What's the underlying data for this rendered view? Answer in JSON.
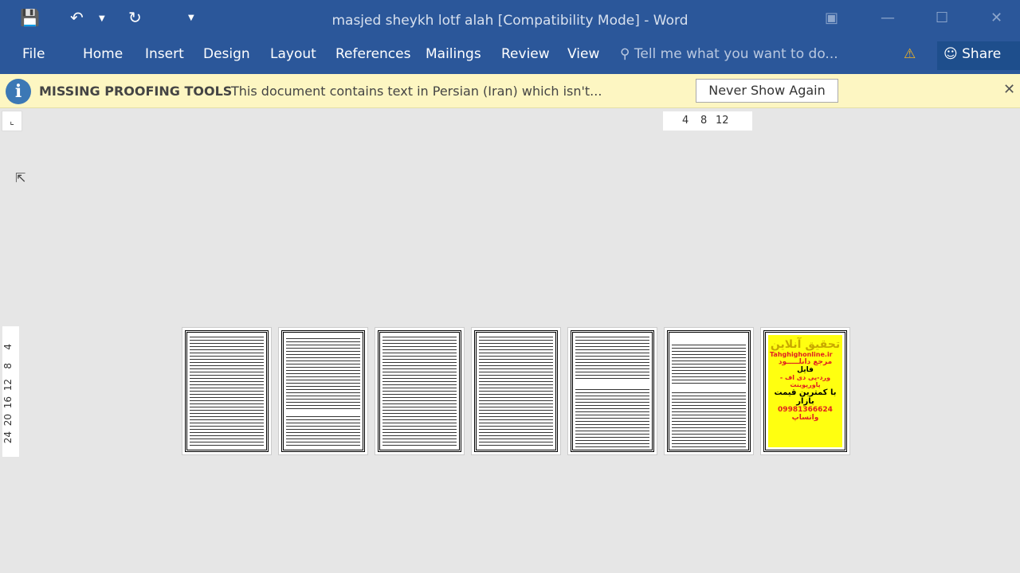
{
  "window": {
    "title": "masjed sheykh lotf alah [Compatibility Mode] - Word"
  },
  "ribbon": {
    "tabs": [
      "File",
      "Home",
      "Insert",
      "Design",
      "Layout",
      "References",
      "Mailings",
      "Review",
      "View"
    ],
    "tell_me": "Tell me what you want to do...",
    "share": "Share"
  },
  "message_bar": {
    "title": "MISSING PROOFING TOOLS",
    "text": "This document contains text in Persian (Iran) which isn't...",
    "button": "Never Show Again"
  },
  "rulers": {
    "horizontal": [
      "4",
      "8",
      "12"
    ],
    "vertical": [
      "4",
      "8",
      "12",
      "16",
      "20",
      "24"
    ]
  },
  "pages": {
    "count": 7,
    "ad": {
      "title": "تحقیق آنلاین",
      "site": "Tahghighonline.ir",
      "line1": "مرجع دانلـــــود",
      "line2": "فایل",
      "line3": "ورد-پی دی اف - پاورپوینت",
      "line4": "با کمترین قیمت بازار",
      "phone": "09981366624",
      "whatsapp": "واتساپ"
    }
  },
  "colors": {
    "brand": "#2b579a",
    "message_bar": "#fdf6c2",
    "ad_bg": "#ffff10",
    "ad_red": "#e02020"
  }
}
